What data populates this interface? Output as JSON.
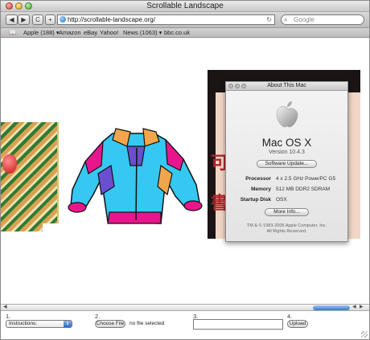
{
  "window": {
    "title": "Scrollable Landscape"
  },
  "toolbar": {
    "back_glyph": "◀",
    "forward_glyph": "▶",
    "refresh_glyph": "C",
    "add_glyph": "+",
    "url": "http://scrollable-landscape.org/",
    "search_placeholder": "Google"
  },
  "bookmarks": {
    "items": [
      "Apple (188) ▾",
      "Amazon",
      "eBay",
      "Yahoo!",
      "News (1063) ▾",
      "bbc.co.uk"
    ]
  },
  "about_mac": {
    "title": "About This Mac",
    "os_name": "Mac OS X",
    "version": "Version 10.4.3",
    "software_update_label": "Software Update...",
    "specs": [
      {
        "key": "Processor",
        "value": "4 x 2.5 GHz PowerPC G5"
      },
      {
        "key": "Memory",
        "value": "512 MB DDR2 SDRAM"
      },
      {
        "key": "Startup Disk",
        "value": "OSX"
      }
    ],
    "more_info_label": "More Info...",
    "legal_line1": "TM & © 1983-2005 Apple Computer, Inc.",
    "legal_line2": "All Rights Reserved."
  },
  "form": {
    "step1": "1.",
    "step2": "2.",
    "step3": "3.",
    "step4": "4.",
    "select_value": "Instructions:",
    "choose_file_label": "Choose File",
    "no_file_text": "no file selected",
    "upload_label": "Upload"
  },
  "colors": {
    "accent_blue": "#3b78c9",
    "jacket_cyan": "#35c8f2",
    "jacket_magenta": "#e8168c",
    "jacket_purple": "#6a4fd0",
    "jacket_orange": "#f2a64b"
  }
}
